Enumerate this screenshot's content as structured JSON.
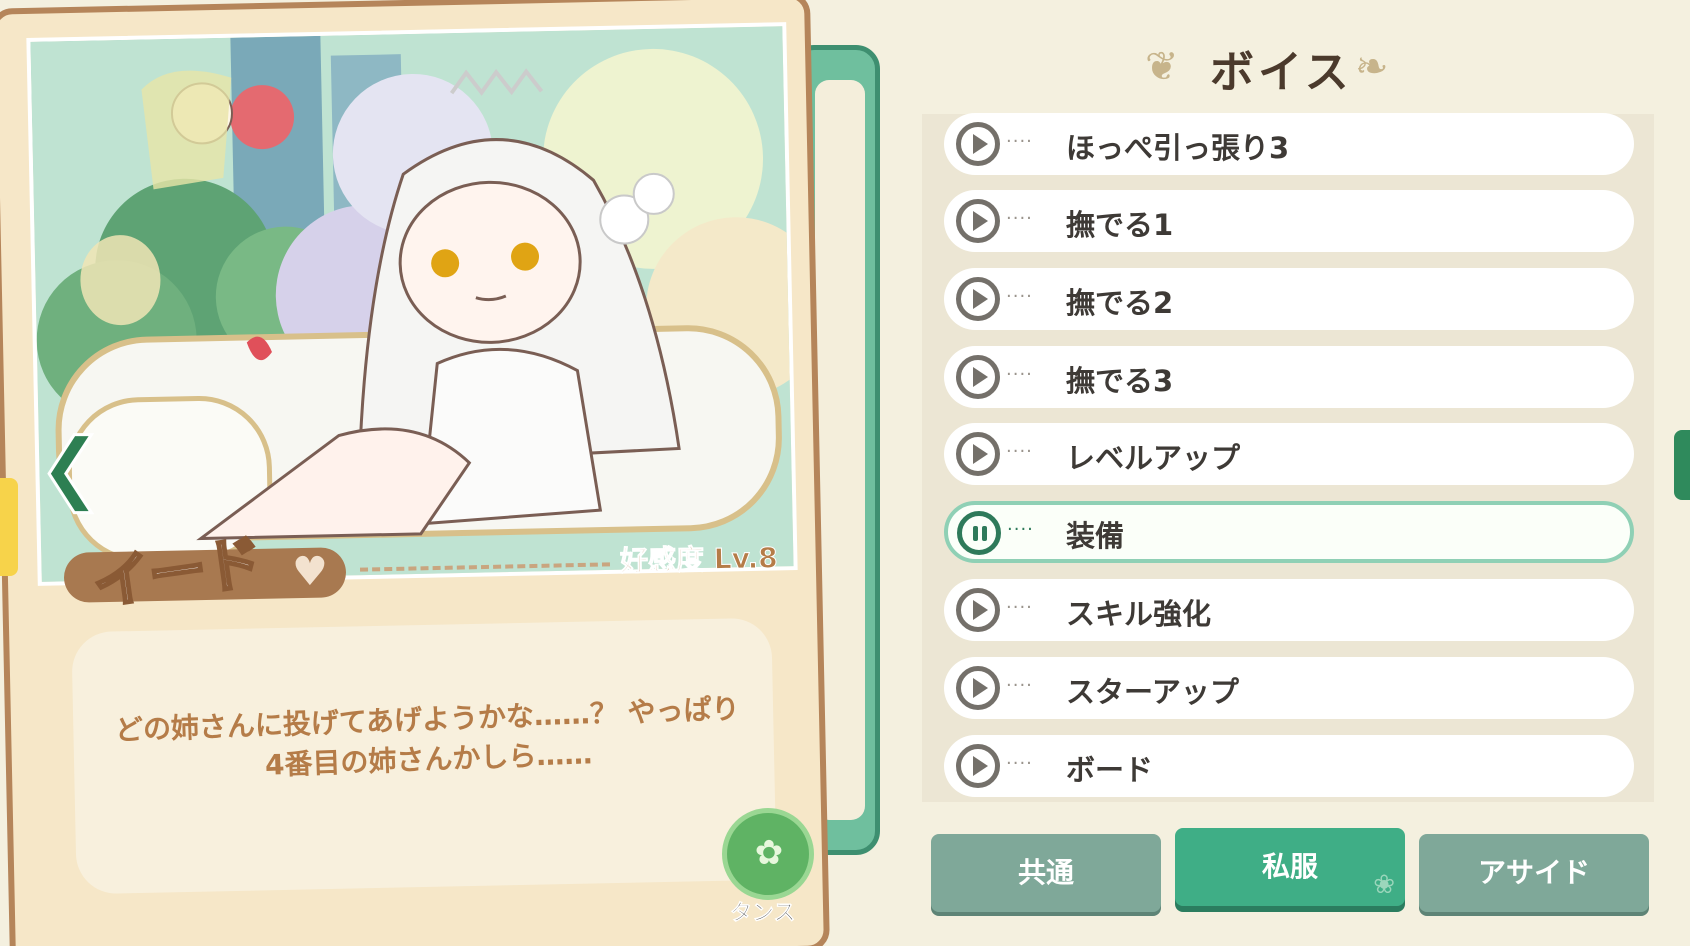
{
  "character": {
    "name": "イード",
    "affinity": "好感度 Lv.8",
    "dialog": "どの姉さんに投げてあげようかな……？ やっぱり4番目の姉さんかしら……"
  },
  "buttons": {
    "wardrobe_label": "タンス",
    "back_icon": "chevron-left-icon",
    "heart_icon": "heart-icon"
  },
  "panel": {
    "title": "ボイス",
    "voices": [
      {
        "label": "ほっぺ引っ張り3",
        "state": "play"
      },
      {
        "label": "撫でる1",
        "state": "play"
      },
      {
        "label": "撫でる2",
        "state": "play"
      },
      {
        "label": "撫でる3",
        "state": "play"
      },
      {
        "label": "レベルアップ",
        "state": "play"
      },
      {
        "label": "装備",
        "state": "playing"
      },
      {
        "label": "スキル強化",
        "state": "play"
      },
      {
        "label": "スターアップ",
        "state": "play"
      },
      {
        "label": "ボード",
        "state": "play"
      }
    ],
    "tabs": [
      {
        "label": "共通",
        "active": false
      },
      {
        "label": "私服",
        "active": true
      },
      {
        "label": "アサイド",
        "active": false
      }
    ]
  },
  "colors": {
    "accent_green": "#3fae86",
    "tab_inactive": "#7fa899",
    "text_brown": "#b57c48"
  }
}
